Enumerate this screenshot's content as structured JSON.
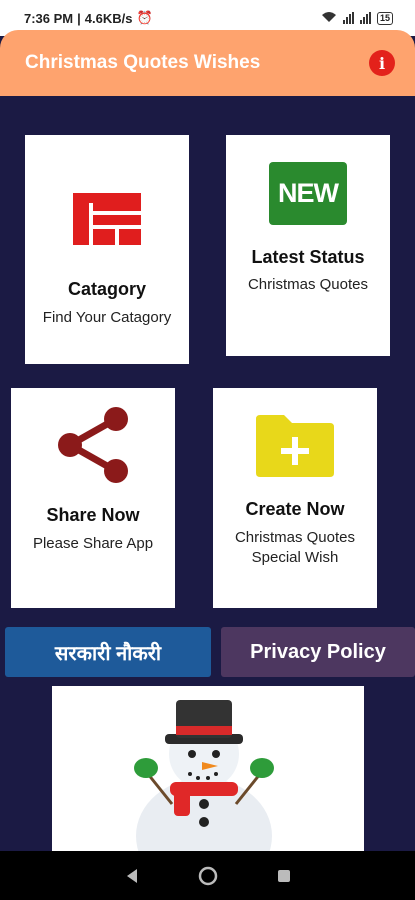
{
  "status_bar": {
    "time": "7:36 PM",
    "speed": "4.6KB/s",
    "battery": "15"
  },
  "app_bar": {
    "title": "Christmas Quotes Wishes",
    "info_icon": "info-icon",
    "info_symbol": "i",
    "background": "#fea36e"
  },
  "cards": {
    "category": {
      "title": "Catagory",
      "subtitle": "Find Your Catagory",
      "icon": "category-grid-icon"
    },
    "latest": {
      "title": "Latest Status",
      "subtitle": "Christmas Quotes",
      "icon": "new-badge-icon",
      "badge": "NEW"
    },
    "share": {
      "title": "Share Now",
      "subtitle": "Please Share App",
      "icon": "share-icon"
    },
    "create": {
      "title": "Create Now",
      "subtitle_line1": "Christmas Quotes",
      "subtitle_line2": "Special Wish",
      "icon": "folder-add-icon"
    }
  },
  "buttons": {
    "sarkari": {
      "label": "सरकारी नौकरी",
      "color": "#1e5a9a"
    },
    "privacy": {
      "label": "Privacy Policy",
      "color": "#4d3760"
    }
  },
  "banner": {
    "icon": "snowman-icon"
  },
  "nav_bar": {
    "back": "back-icon",
    "home": "home-icon",
    "recents": "recents-icon"
  }
}
